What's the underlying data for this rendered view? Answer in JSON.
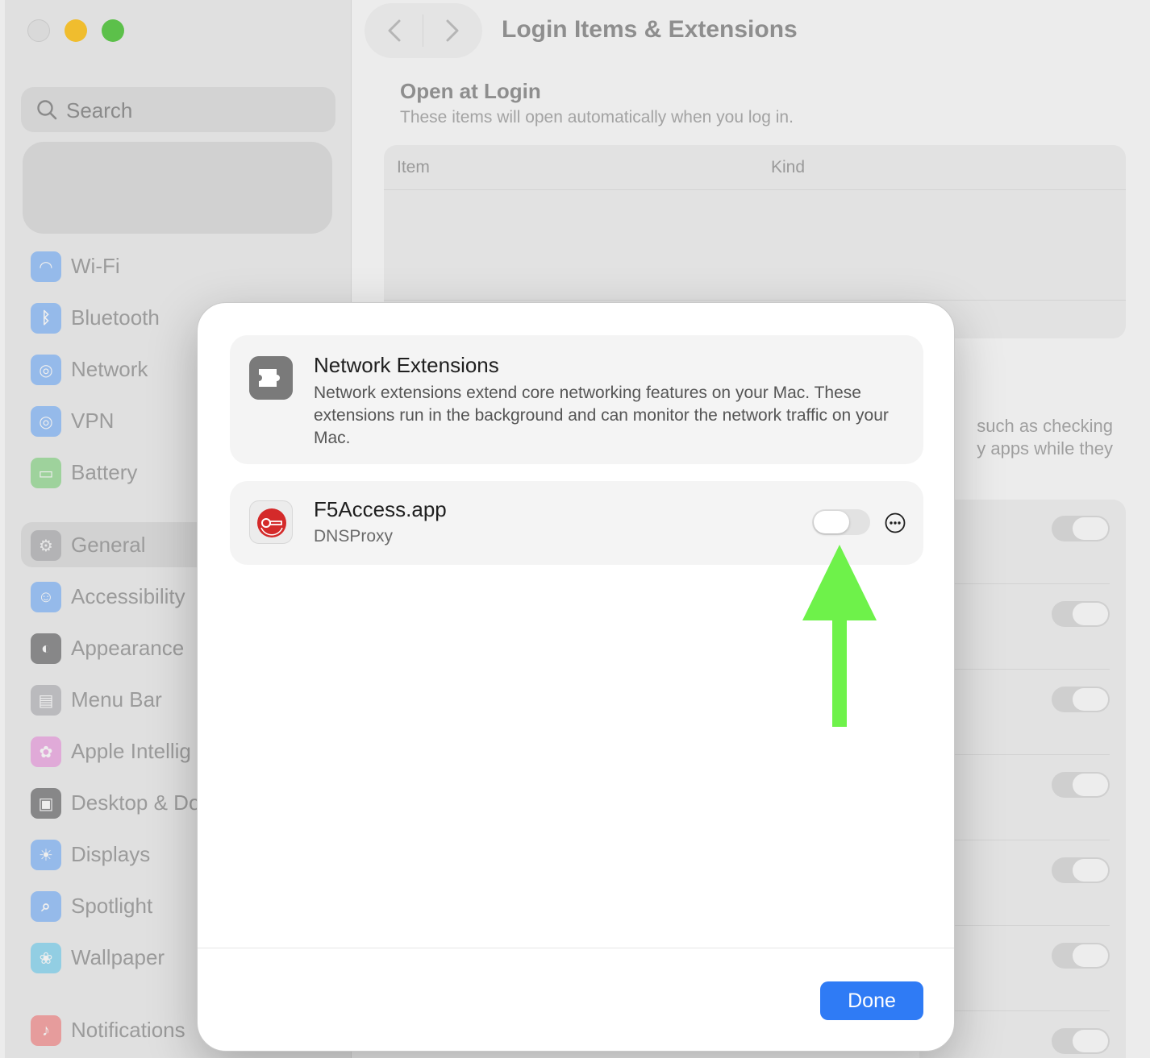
{
  "window": {
    "title": "Login Items & Extensions"
  },
  "search": {
    "placeholder": "Search"
  },
  "sidebar": {
    "items": [
      {
        "label": "Wi-Fi",
        "icon": "wifi-icon",
        "color": "#3b8df7"
      },
      {
        "label": "Bluetooth",
        "icon": "bluetooth-icon",
        "color": "#3b8df7"
      },
      {
        "label": "Network",
        "icon": "globe-icon",
        "color": "#3b8df7"
      },
      {
        "label": "VPN",
        "icon": "vpn-globe-icon",
        "color": "#3b8df7"
      },
      {
        "label": "Battery",
        "icon": "battery-icon",
        "color": "#4fc24a"
      },
      {
        "label": "General",
        "icon": "gear-icon",
        "color": "#8e8e93"
      },
      {
        "label": "Accessibility",
        "icon": "accessibility-icon",
        "color": "#3b8df7"
      },
      {
        "label": "Appearance",
        "icon": "appearance-icon",
        "color": "#1c1c1e"
      },
      {
        "label": "Menu Bar",
        "icon": "menu-bar-icon",
        "color": "#8e8e93"
      },
      {
        "label": "Apple Intellig",
        "icon": "apple-intelligence-icon",
        "color": "#e06ad0"
      },
      {
        "label": "Desktop & Do",
        "icon": "desktop-dock-icon",
        "color": "#1c1c1e"
      },
      {
        "label": "Displays",
        "icon": "brightness-icon",
        "color": "#3b8df7"
      },
      {
        "label": "Spotlight",
        "icon": "spotlight-icon",
        "color": "#3b8df7"
      },
      {
        "label": "Wallpaper",
        "icon": "wallpaper-flower-icon",
        "color": "#35b9e8"
      },
      {
        "label": "Notifications",
        "icon": "bell-icon",
        "color": "#ee4b4b"
      }
    ]
  },
  "open_at_login": {
    "title": "Open at Login",
    "subtitle": "These items will open automatically when you log in.",
    "columns": [
      "Item",
      "Kind"
    ]
  },
  "background_text": {
    "line1": "such as checking",
    "line2": "y apps while they"
  },
  "modal": {
    "header": {
      "title": "Network Extensions",
      "description": "Network extensions extend core networking features on your Mac. These extensions run in the background and can monitor the network traffic on your Mac."
    },
    "extension": {
      "name": "F5Access.app",
      "kind": "DNSProxy",
      "enabled": false
    },
    "done_label": "Done"
  },
  "colors": {
    "accent": "#2f7bf5",
    "annotation_arrow": "#6ef24a",
    "f5_red": "#d42a2a"
  }
}
